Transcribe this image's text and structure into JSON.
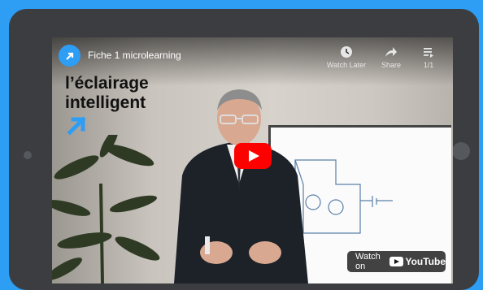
{
  "video": {
    "channel_title": "Fiche 1 microlearning",
    "brand_line1": "l’éclairage",
    "brand_line2": "intelligent",
    "controls": {
      "watch_later": "Watch Later",
      "share": "Share",
      "playlist_count": "1/1"
    },
    "watch_on": "Watch on",
    "youtube_label": "YouTube"
  },
  "colors": {
    "page_background": "#2e9df4",
    "tablet_frame": "#3b3d40",
    "play_button": "#ff0000",
    "brand_accent": "#2e9df4"
  },
  "icons": [
    "clock-icon",
    "share-arrow-icon",
    "playlist-icon",
    "channel-logo-icon",
    "brand-arrow-icon",
    "youtube-logo-icon"
  ]
}
